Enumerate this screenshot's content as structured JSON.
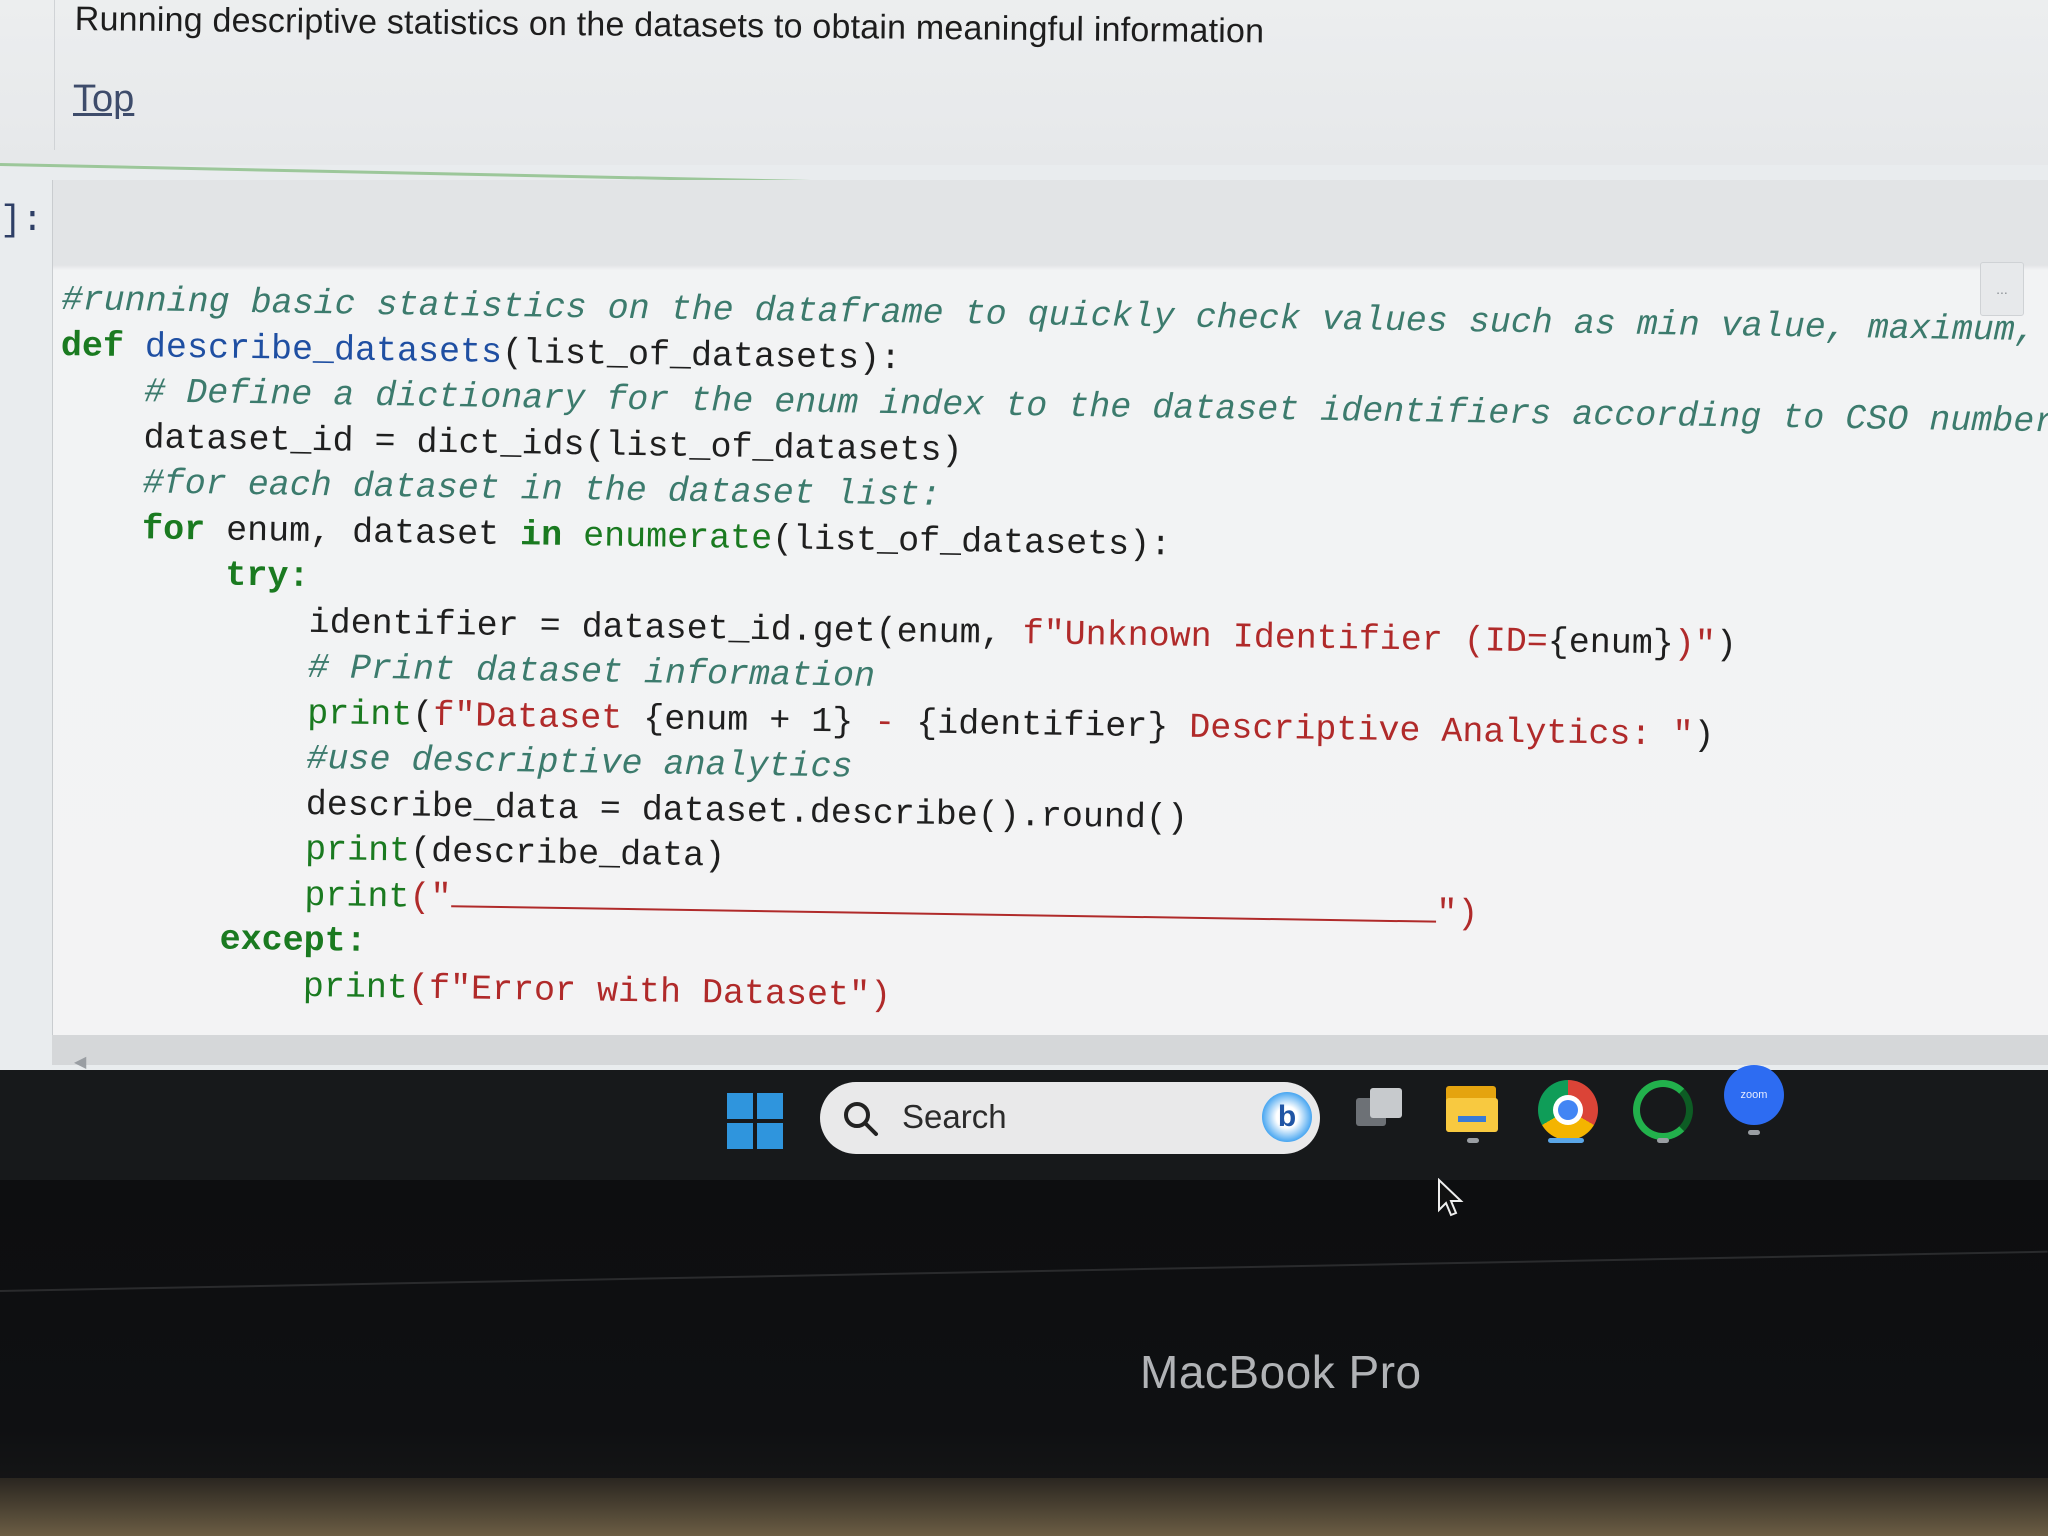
{
  "markdown": {
    "heading": "Running descriptive statistics on the datasets to obtain meaningful information",
    "top_link": "Top"
  },
  "cell": {
    "prompt": "]:",
    "menu_label": "..."
  },
  "code": {
    "l1": "#running basic statistics on the dataframe to quickly check values such as min value, maximum, mean, r",
    "l2_def": "def",
    "l2_fn": "describe_datasets",
    "l2_rest": "(list_of_datasets):",
    "l3": "# Define a dictionary for the enum index to the dataset identifiers according to CSO numbers",
    "l4": "dataset_id = dict_ids(list_of_datasets)",
    "l5": "#for each dataset in the dataset list:",
    "l6_for": "for",
    "l6_mid": " enum, dataset ",
    "l6_in": "in",
    "l6_fn": "enumerate",
    "l6_rest": "(list_of_datasets):",
    "l7": "try:",
    "l8_a": "identifier = dataset_id.get(enum, ",
    "l8_str": "f\"Unknown Identifier (ID=",
    "l8_var": "{enum}",
    "l8_end": ")\"",
    "l8_close": ")",
    "l9": "# Print dataset information",
    "l10_print": "print",
    "l10_a": "(",
    "l10_str1": "f\"Dataset ",
    "l10_var1": "{enum + 1}",
    "l10_str2": " - ",
    "l10_var2": "{identifier}",
    "l10_str3": " Descriptive Analytics: \"",
    "l10_close": ")",
    "l11": "#use descriptive analytics",
    "l12": "describe_data = dataset.describe().round()",
    "l13_print": "print",
    "l13_rest": "(describe_data)",
    "l14_print": "print",
    "l14_open": "(\"",
    "l14_close": "\")",
    "l15": "except:",
    "l16_print": "print",
    "l16_str": "(f\"Error with Dataset\")"
  },
  "taskbar": {
    "search_placeholder": "Search",
    "bing_letter": "b",
    "zoom_label": "zoom",
    "start_icon": "windows-logo",
    "apps": [
      "task-view",
      "file-explorer",
      "chrome",
      "green-ring-app",
      "zoom"
    ]
  },
  "hardware": {
    "label": "MacBook Pro"
  },
  "colors": {
    "comment": "#3c7b6d",
    "keyword": "#1a7a20",
    "function": "#1f4fa2",
    "string": "#b02a2a",
    "taskbar": "#17191b",
    "windows_blue": "#2f95dd"
  }
}
